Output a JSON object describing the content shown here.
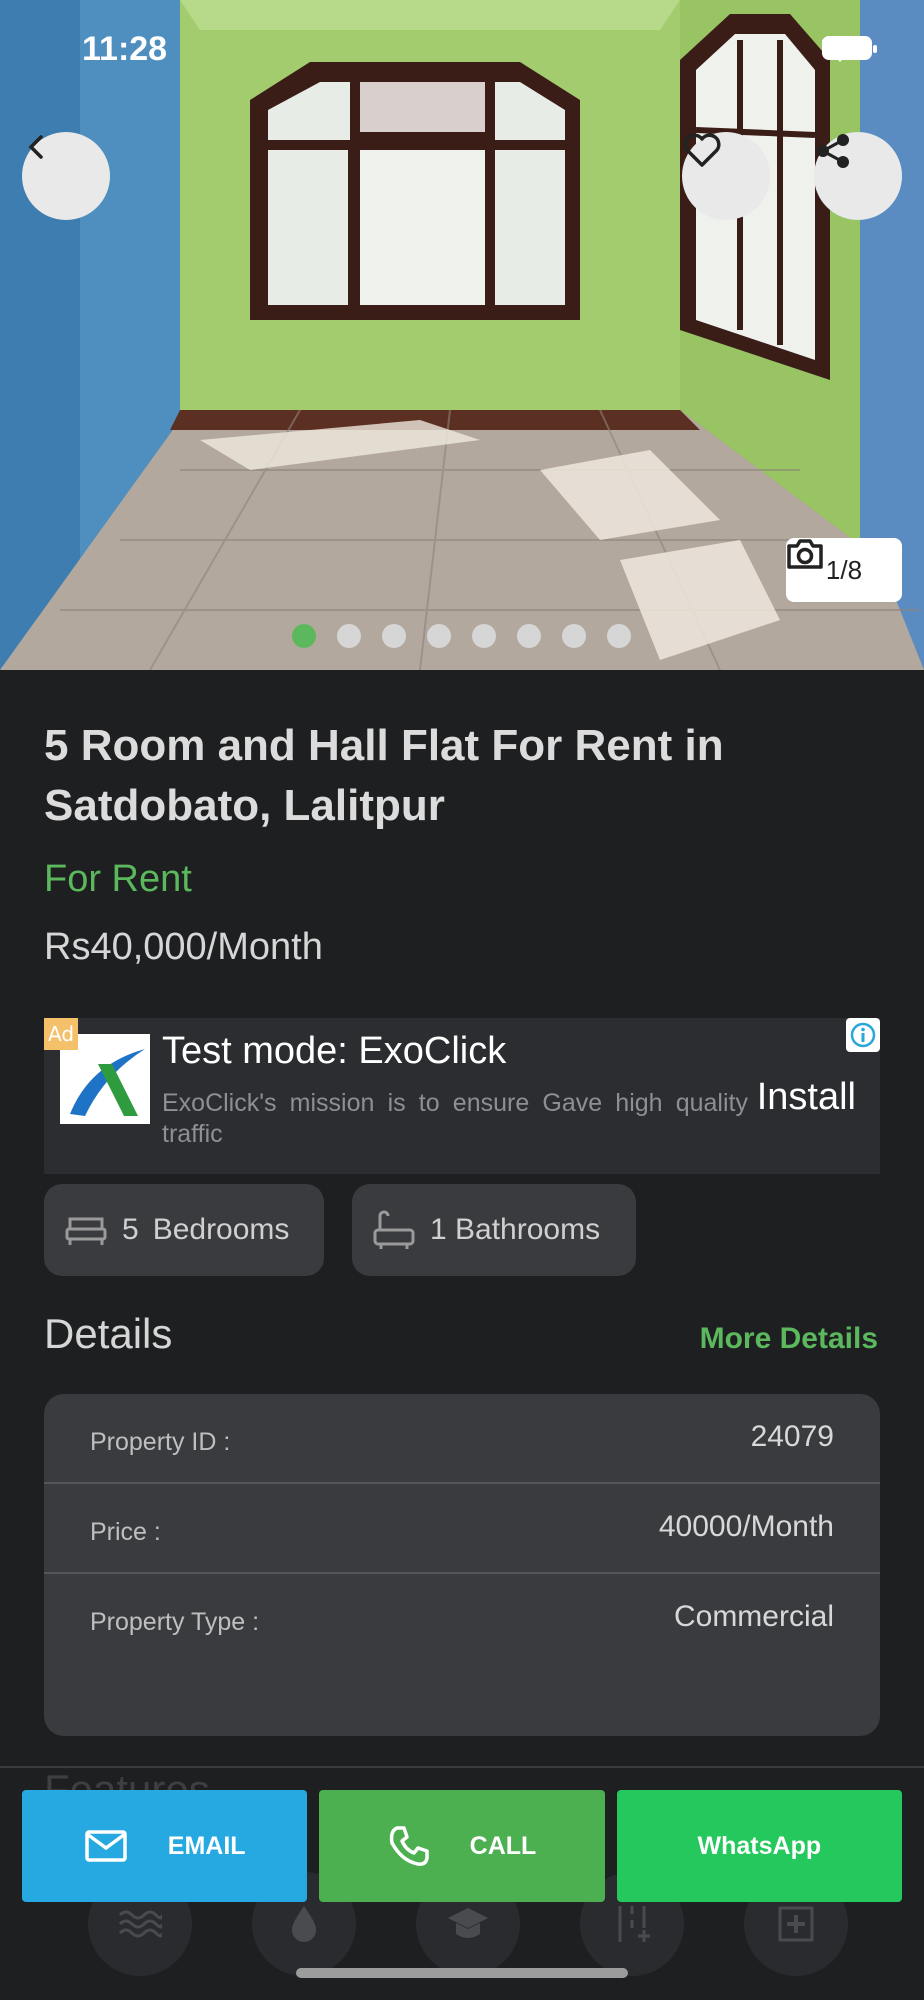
{
  "status_bar": {
    "time": "11:28"
  },
  "gallery": {
    "photo_counter": "1/8",
    "dot_count": 8,
    "active_dot": 0
  },
  "listing": {
    "title": "5 Room and Hall Flat For Rent in Satdobato, Lalitpur",
    "purpose": "For Rent",
    "price": "Rs40,000/Month"
  },
  "ad": {
    "badge": "Ad",
    "title": "Test mode: ExoClick",
    "description": "ExoClick's mission is to ensure Gave high quality traffic",
    "cta": "Install"
  },
  "features": {
    "bedrooms_count": "5",
    "bedrooms_label": "Bedrooms",
    "bathrooms_label": "1 Bathrooms"
  },
  "details": {
    "heading": "Details",
    "more_link": "More Details",
    "rows": [
      {
        "label": "Property ID :",
        "value": "24079"
      },
      {
        "label": "Price :",
        "value": "40000/Month"
      },
      {
        "label": "Property Type :",
        "value": "Commercial"
      }
    ]
  },
  "features_section": {
    "heading": "Features"
  },
  "actions": {
    "email": "EMAIL",
    "call": "CALL",
    "whatsapp": "WhatsApp"
  },
  "colors": {
    "accent_green": "#5cb85c",
    "email_blue": "#25a9e0",
    "call_green": "#4caf50",
    "whatsapp_green": "#25c85c",
    "background": "#1e1f21"
  }
}
